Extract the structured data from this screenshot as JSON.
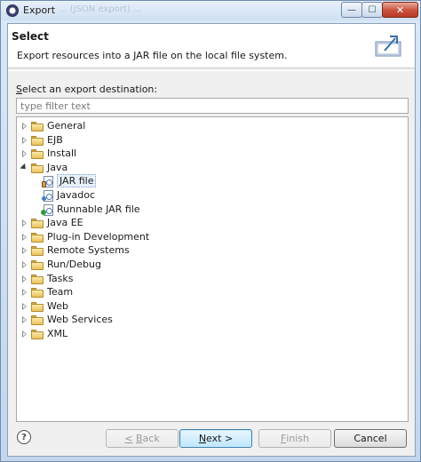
{
  "window": {
    "title": "Export",
    "background_title_hint": "... (JSON export) ..."
  },
  "banner": {
    "title": "Select",
    "description": "Export resources into a JAR file on the local file system."
  },
  "destination_label": "Select an export destination:",
  "filter": {
    "placeholder": "type filter text",
    "value": ""
  },
  "tree": [
    {
      "label": "General",
      "kind": "folder",
      "expanded": false
    },
    {
      "label": "EJB",
      "kind": "folder",
      "expanded": false
    },
    {
      "label": "Install",
      "kind": "folder",
      "expanded": false
    },
    {
      "label": "Java",
      "kind": "folder",
      "expanded": true,
      "children": [
        {
          "label": "JAR file",
          "kind": "jar",
          "selected": true
        },
        {
          "label": "Javadoc",
          "kind": "javadoc"
        },
        {
          "label": "Runnable JAR file",
          "kind": "runnable"
        }
      ]
    },
    {
      "label": "Java EE",
      "kind": "folder",
      "expanded": false
    },
    {
      "label": "Plug-in Development",
      "kind": "folder",
      "expanded": false
    },
    {
      "label": "Remote Systems",
      "kind": "folder",
      "expanded": false
    },
    {
      "label": "Run/Debug",
      "kind": "folder",
      "expanded": false
    },
    {
      "label": "Tasks",
      "kind": "folder",
      "expanded": false
    },
    {
      "label": "Team",
      "kind": "folder",
      "expanded": false
    },
    {
      "label": "Web",
      "kind": "folder",
      "expanded": false
    },
    {
      "label": "Web Services",
      "kind": "folder",
      "expanded": false
    },
    {
      "label": "XML",
      "kind": "folder",
      "expanded": false
    }
  ],
  "buttons": {
    "help_icon": "?",
    "back": "< Back",
    "next": "Next >",
    "finish": "Finish",
    "cancel": "Cancel"
  },
  "titlebar_buttons": {
    "minimize": "—",
    "maximize": "☐",
    "close": "✕"
  },
  "icons": {
    "app": "eclipse-icon",
    "banner": "export-icon",
    "folder": "folder-icon",
    "jar": "jar-file-icon",
    "javadoc": "javadoc-icon",
    "runnable": "runnable-jar-icon",
    "help": "help-icon"
  },
  "colors": {
    "title_gradient_top": "#e7f0fa",
    "dialog_bg": "#f0f0f0",
    "default_button": "#bee6fd",
    "close_button": "#c9503b"
  }
}
